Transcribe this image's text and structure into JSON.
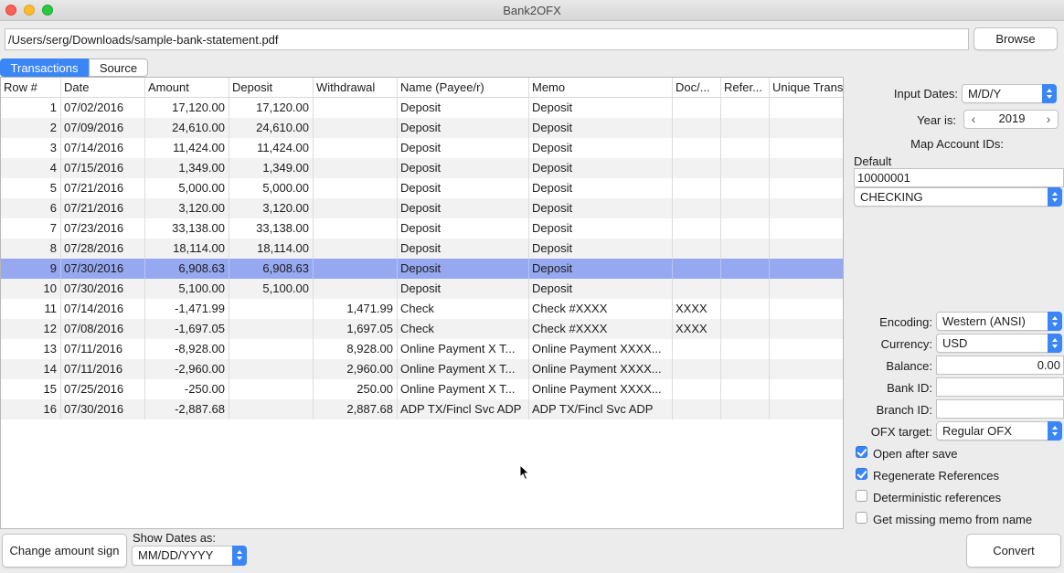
{
  "window": {
    "title": "Bank2OFX"
  },
  "file": {
    "path": "/Users/serg/Downloads/sample-bank-statement.pdf",
    "browse_label": "Browse"
  },
  "tabs": [
    {
      "label": "Transactions",
      "active": true
    },
    {
      "label": "Source",
      "active": false
    }
  ],
  "table": {
    "columns": [
      "Row #",
      "Date",
      "Amount",
      "Deposit",
      "Withdrawal",
      "Name (Payee/r)",
      "Memo",
      "Doc/...",
      "Refer...",
      "Unique Trans"
    ],
    "rows": [
      [
        "1",
        "07/02/2016",
        "17,120.00",
        "17,120.00",
        "",
        "Deposit",
        "Deposit",
        "",
        "",
        ""
      ],
      [
        "2",
        "07/09/2016",
        "24,610.00",
        "24,610.00",
        "",
        "Deposit",
        "Deposit",
        "",
        "",
        ""
      ],
      [
        "3",
        "07/14/2016",
        "11,424.00",
        "11,424.00",
        "",
        "Deposit",
        "Deposit",
        "",
        "",
        ""
      ],
      [
        "4",
        "07/15/2016",
        "1,349.00",
        "1,349.00",
        "",
        "Deposit",
        "Deposit",
        "",
        "",
        ""
      ],
      [
        "5",
        "07/21/2016",
        "5,000.00",
        "5,000.00",
        "",
        "Deposit",
        "Deposit",
        "",
        "",
        ""
      ],
      [
        "6",
        "07/21/2016",
        "3,120.00",
        "3,120.00",
        "",
        "Deposit",
        "Deposit",
        "",
        "",
        ""
      ],
      [
        "7",
        "07/23/2016",
        "33,138.00",
        "33,138.00",
        "",
        "Deposit",
        "Deposit",
        "",
        "",
        ""
      ],
      [
        "8",
        "07/28/2016",
        "18,114.00",
        "18,114.00",
        "",
        "Deposit",
        "Deposit",
        "",
        "",
        ""
      ],
      [
        "9",
        "07/30/2016",
        "6,908.63",
        "6,908.63",
        "",
        "Deposit",
        "Deposit",
        "",
        "",
        ""
      ],
      [
        "10",
        "07/30/2016",
        "5,100.00",
        "5,100.00",
        "",
        "Deposit",
        "Deposit",
        "",
        "",
        ""
      ],
      [
        "11",
        "07/14/2016",
        "-1,471.99",
        "",
        "1,471.99",
        "Check",
        "Check #XXXX",
        "XXXX",
        "",
        ""
      ],
      [
        "12",
        "07/08/2016",
        "-1,697.05",
        "",
        "1,697.05",
        "Check",
        "Check #XXXX",
        "XXXX",
        "",
        ""
      ],
      [
        "13",
        "07/11/2016",
        "-8,928.00",
        "",
        "8,928.00",
        "Online Payment X T...",
        "Online Payment XXXX...",
        "",
        "",
        ""
      ],
      [
        "14",
        "07/11/2016",
        "-2,960.00",
        "",
        "2,960.00",
        "Online Payment X T...",
        "Online Payment XXXX...",
        "",
        "",
        ""
      ],
      [
        "15",
        "07/25/2016",
        "-250.00",
        "",
        "250.00",
        "Online Payment X T...",
        "Online Payment XXXX...",
        "",
        "",
        ""
      ],
      [
        "16",
        "07/30/2016",
        "-2,887.68",
        "",
        "2,887.68",
        "ADP TX/Fincl Svc ADP",
        "ADP TX/Fincl Svc ADP",
        "",
        "",
        ""
      ]
    ],
    "selected_row": 9
  },
  "panel": {
    "input_dates_label": "Input Dates:",
    "input_dates_value": "M/D/Y",
    "year_label": "Year is:",
    "year_value": "2019",
    "map_ids_label": "Map Account IDs:",
    "default_label": "Default",
    "account_id": "10000001",
    "account_type": "CHECKING",
    "encoding_label": "Encoding:",
    "encoding_value": "Western (ANSI)",
    "currency_label": "Currency:",
    "currency_value": "USD",
    "balance_label": "Balance:",
    "balance_value": "0.00",
    "bank_id_label": "Bank ID:",
    "bank_id_value": "",
    "branch_id_label": "Branch ID:",
    "branch_id_value": "",
    "ofx_target_label": "OFX target:",
    "ofx_target_value": "Regular OFX",
    "checkboxes": [
      {
        "label": "Open after save",
        "checked": true
      },
      {
        "label": "Regenerate References",
        "checked": true
      },
      {
        "label": "Deterministic references",
        "checked": false
      },
      {
        "label": "Get missing memo from name",
        "checked": false
      }
    ]
  },
  "bottom": {
    "change_sign_label": "Change amount sign",
    "show_dates_label": "Show Dates as:",
    "show_dates_value": "MM/DD/YYYY",
    "convert_label": "Convert"
  },
  "colors": {
    "accent": "#3b86f7",
    "selection": "#96a8f0"
  }
}
